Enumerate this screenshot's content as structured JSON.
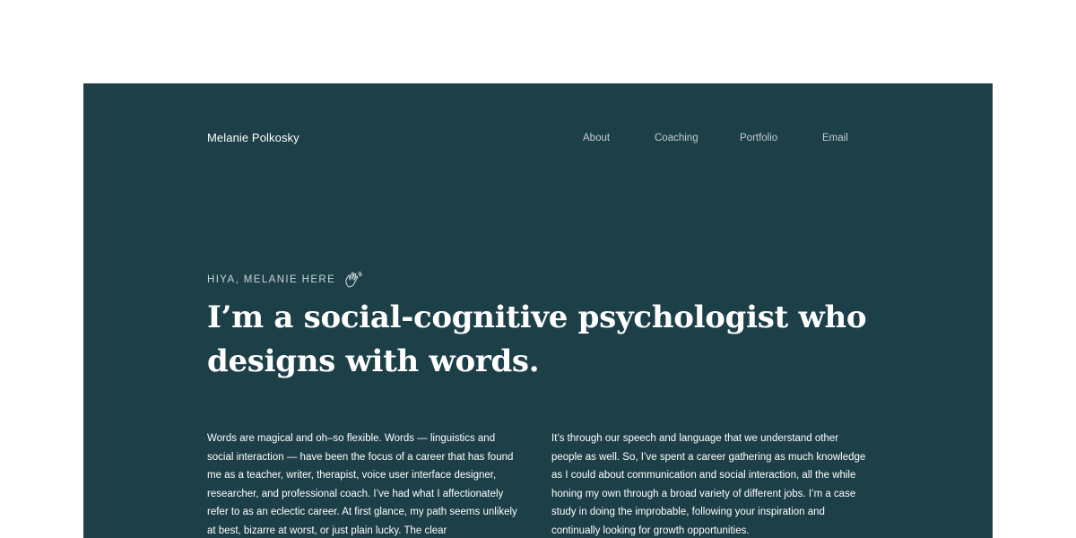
{
  "header": {
    "brand": "Melanie Polkosky",
    "nav": [
      "About",
      "Coaching",
      "Portfolio",
      "Email"
    ]
  },
  "hero": {
    "eyebrow": "HIYA, MELANIE HERE",
    "eyebrow_icon": "waving-hand-icon",
    "headline": "I’m a social-cognitive psychologist who designs with words."
  },
  "intro": {
    "left": "Words are magical and oh–so flexible. Words — linguistics and social interaction — have been the focus of a career that has found me as a teacher, writer, therapist, voice user interface designer, researcher, and professional coach. I’ve had what I affectionately refer to as an eclectic career. At first glance, my path seems unlikely at best, bizarre at worst, or just plain lucky. The clear",
    "right": "It’s through our speech and language that we understand other people as well. So, I’ve spent a career gathering as much knowledge as I could about communication and social interaction, all the while honing my own through a broad variety of different jobs. I’m a case study in doing the improbable, following your inspiration and continually looking for growth opportunities."
  },
  "colors": {
    "page_background": "#ffffff",
    "panel_background": "#1c3f48",
    "text": "#ffffff",
    "muted_text": "#c3cfd2"
  }
}
